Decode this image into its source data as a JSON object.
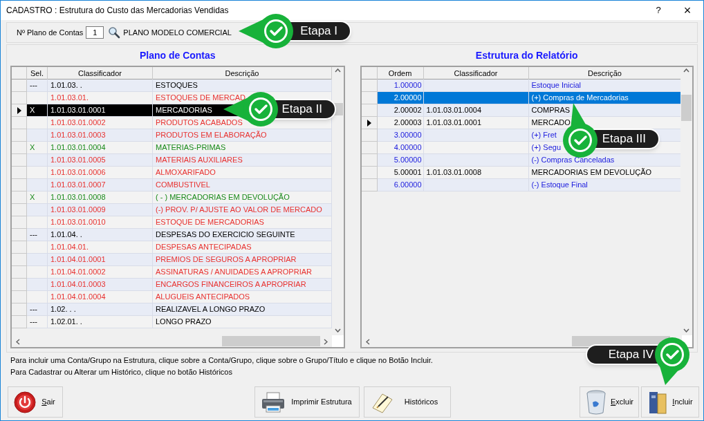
{
  "window": {
    "title": "CADASTRO : Estrutura do Custo das Mercadorias Vendidas",
    "help": "?",
    "close": "×"
  },
  "plan": {
    "label": "Nº Plano de Contas",
    "value": "1",
    "name": "PLANO MODELO COMERCIAL"
  },
  "accounts": {
    "title": "Plano de Contas",
    "columns": [
      "Sel.",
      "Classificador",
      "Descrição"
    ],
    "rows": [
      {
        "sel": "---",
        "code": "1.01.03.  .",
        "desc": "ESTOQUES",
        "color": "#000000",
        "current": false
      },
      {
        "sel": "",
        "code": "1.01.03.01.",
        "desc": "ESTOQUES DE MERCAD",
        "color": "#e8312f",
        "current": false
      },
      {
        "sel": "X",
        "code": "1.01.03.01.0001",
        "desc": "MERCADORIAS",
        "current": true
      },
      {
        "sel": "",
        "code": "1.01.03.01.0002",
        "desc": "PRODUTOS ACABADOS",
        "color": "#e8312f",
        "current": false
      },
      {
        "sel": "",
        "code": "1.01.03.01.0003",
        "desc": "PRODUTOS EM ELABORAÇÃO",
        "color": "#e8312f",
        "current": false
      },
      {
        "sel": "X",
        "code": "1.01.03.01.0004",
        "desc": "MATERIAS-PRIMAS",
        "color": "#1a8a1a",
        "current": false
      },
      {
        "sel": "",
        "code": "1.01.03.01.0005",
        "desc": "MATERIAIS AUXILIARES",
        "color": "#e8312f",
        "current": false
      },
      {
        "sel": "",
        "code": "1.01.03.01.0006",
        "desc": "ALMOXARIFADO",
        "color": "#e8312f",
        "current": false
      },
      {
        "sel": "",
        "code": "1.01.03.01.0007",
        "desc": "COMBUSTIVEL",
        "color": "#e8312f",
        "current": false
      },
      {
        "sel": "X",
        "code": "1.01.03.01.0008",
        "desc": "( - ) MERCADORIAS EM DEVOLUÇÃO",
        "color": "#1a8a1a",
        "current": false
      },
      {
        "sel": "",
        "code": "1.01.03.01.0009",
        "desc": "(-) PROV. P/ AJUSTE AO VALOR DE MERCADO",
        "color": "#e8312f",
        "current": false
      },
      {
        "sel": "",
        "code": "1.01.03.01.0010",
        "desc": "ESTOQUE DE MERCADORIAS",
        "color": "#e8312f",
        "current": false
      },
      {
        "sel": "---",
        "code": "1.01.04.  .",
        "desc": "DESPESAS DO EXERCICIO SEGUINTE",
        "color": "#000000",
        "current": false
      },
      {
        "sel": "",
        "code": "1.01.04.01.",
        "desc": "DESPESAS ANTECIPADAS",
        "color": "#e8312f",
        "current": false
      },
      {
        "sel": "",
        "code": "1.01.04.01.0001",
        "desc": "PREMIOS DE SEGUROS A APROPRIAR",
        "color": "#e8312f",
        "current": false
      },
      {
        "sel": "",
        "code": "1.01.04.01.0002",
        "desc": "ASSINATURAS / ANUIDADES A APROPRIAR",
        "color": "#e8312f",
        "current": false
      },
      {
        "sel": "",
        "code": "1.01.04.01.0003",
        "desc": "ENCARGOS FINANCEIROS A APROPRIAR",
        "color": "#e8312f",
        "current": false
      },
      {
        "sel": "",
        "code": "1.01.04.01.0004",
        "desc": "ALUGUEIS ANTECIPADOS",
        "color": "#e8312f",
        "current": false
      },
      {
        "sel": "---",
        "code": "1.02.  .  .",
        "desc": "REALIZAVEL A LONGO PRAZO",
        "color": "#000000",
        "current": false
      },
      {
        "sel": "---",
        "code": "1.02.01.  .",
        "desc": "LONGO PRAZO",
        "color": "#000000",
        "current": false
      }
    ]
  },
  "report": {
    "title": "Estrutura do Relatório",
    "columns": [
      "Ordem",
      "Classificador",
      "Descrição"
    ],
    "rows": [
      {
        "order": "1.00000",
        "code": "",
        "desc": "Estoque Inicial",
        "color": "#1a1add",
        "selected": false,
        "current": false
      },
      {
        "order": "2.00000",
        "code": "",
        "desc": "(+) Compras de Mercadorias",
        "selected": true,
        "current": false
      },
      {
        "order": "2.00002",
        "code": "1.01.03.01.0004",
        "desc": "COMPRAS",
        "color": "#000000",
        "selected": false,
        "current": false
      },
      {
        "order": "2.00003",
        "code": "1.01.03.01.0001",
        "desc": "MERCADO",
        "color": "#000000",
        "selected": false,
        "current": true
      },
      {
        "order": "3.00000",
        "code": "",
        "desc": "(+) Fret",
        "color": "#1a1add",
        "selected": false,
        "current": false
      },
      {
        "order": "4.00000",
        "code": "",
        "desc": "(+) Segu",
        "color": "#1a1add",
        "selected": false,
        "current": false
      },
      {
        "order": "5.00000",
        "code": "",
        "desc": "(-) Compras Canceladas",
        "color": "#1a1add",
        "selected": false,
        "current": false
      },
      {
        "order": "5.00001",
        "code": "1.01.03.01.0008",
        "desc": "MERCADORIAS EM DEVOLUÇÃO",
        "color": "#000000",
        "selected": false,
        "current": false
      },
      {
        "order": "6.00000",
        "code": "",
        "desc": "(-) Estoque Final",
        "color": "#1a1add",
        "selected": false,
        "current": false
      }
    ]
  },
  "hints": [
    "Para incluir uma Conta/Grupo na Estrutura, clique sobre a Conta/Grupo, clique sobre o Grupo/Título e clique no Botão Incluir.",
    "Para Cadastrar ou Alterar um Histórico, clique no botão Históricos"
  ],
  "buttons": [
    {
      "kind": "exit",
      "label": "Sair",
      "underline": true
    },
    {
      "kind": "print",
      "label": "Imprimir Estrutura",
      "underline": false
    },
    {
      "kind": "history",
      "label": "Históricos",
      "underline": false
    },
    {
      "kind": "delete",
      "label": "Excluir",
      "underline": true
    },
    {
      "kind": "add",
      "label": "Incluir",
      "underline": true
    }
  ],
  "callouts": [
    {
      "label": "Etapa I",
      "kind": "left"
    },
    {
      "label": "Etapa II",
      "kind": "left"
    },
    {
      "label": "Etapa III",
      "kind": "up"
    },
    {
      "label": "Etapa IV",
      "kind": "down"
    }
  ]
}
